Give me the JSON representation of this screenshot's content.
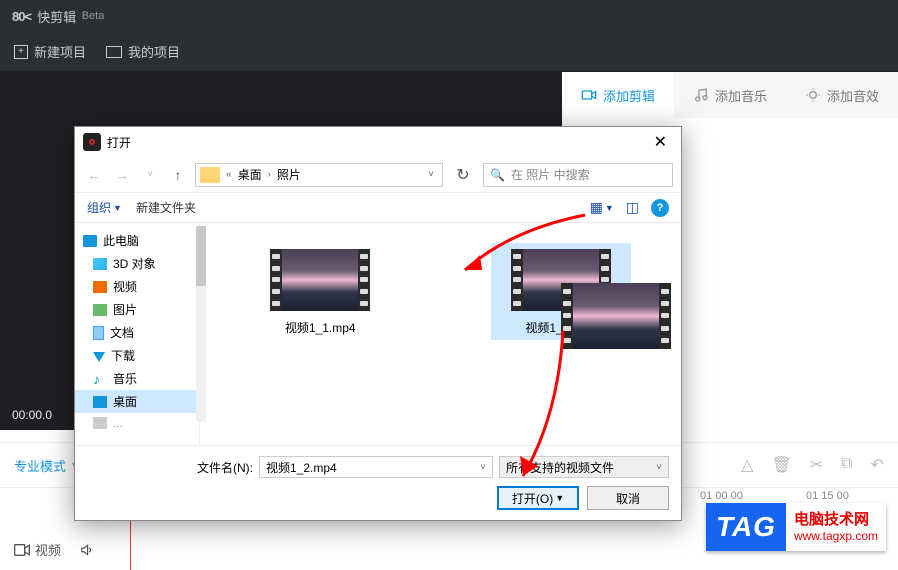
{
  "titlebar": {
    "logo": "80<",
    "app": "快剪辑",
    "beta": "Beta"
  },
  "toolbar": {
    "new_project": "新建项目",
    "my_projects": "我的项目"
  },
  "tabs": {
    "add_clip": "添加剪辑",
    "add_music": "添加音乐",
    "add_sfx": "添加音效"
  },
  "preview": {
    "timecode": "00:00.0"
  },
  "mode": {
    "pro": "专业模式"
  },
  "timeline": {
    "video_label": "视频"
  },
  "times": {
    "t1": "01 00 00",
    "t2": "01 15 00"
  },
  "dialog": {
    "title": "打开",
    "path": {
      "seg1": "桌面",
      "seg2": "照片"
    },
    "search_placeholder": "在 照片 中搜索",
    "organize": "组织",
    "new_folder": "新建文件夹",
    "tree": {
      "this_pc": "此电脑",
      "objects_3d": "3D 对象",
      "videos": "视频",
      "pictures": "图片",
      "documents": "文档",
      "downloads": "下载",
      "music": "音乐",
      "desktop": "桌面",
      "truncated": "..."
    },
    "files": {
      "f1": "视频1_1.mp4",
      "f2": "视频1_2.mp4"
    },
    "filename_label": "文件名(N):",
    "filename_value": "视频1_2.mp4",
    "filetype": "所有支持的视频文件",
    "open_btn": "打开(O)",
    "cancel_btn": "取消"
  },
  "watermark": {
    "tag": "TAG",
    "line1": "电脑技术网",
    "line2": "www.tagxp.com"
  }
}
